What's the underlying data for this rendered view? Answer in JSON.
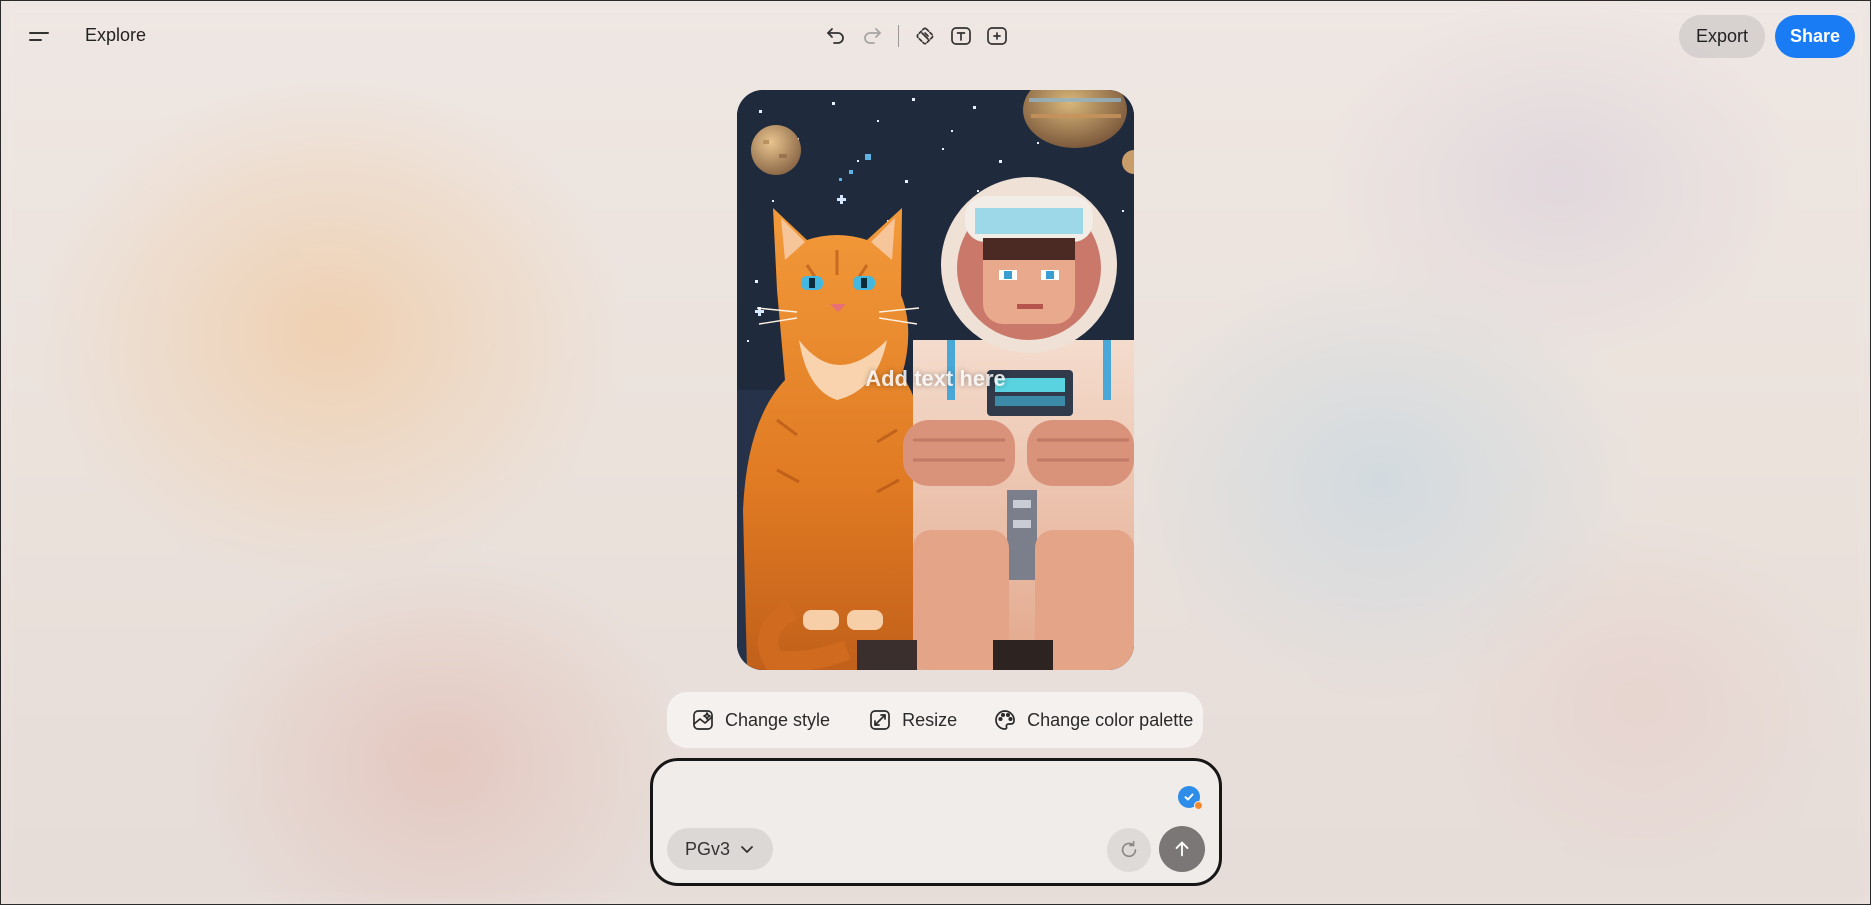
{
  "nav": {
    "explore_label": "Explore"
  },
  "toolbar": {
    "undo_icon": "undo-icon",
    "redo_icon": "redo-icon",
    "tools": [
      "remove-background-icon",
      "text-tool-icon",
      "expand-tool-icon"
    ]
  },
  "header": {
    "export_label": "Export",
    "share_label": "Share",
    "share_color": "#1a7cf5"
  },
  "canvas": {
    "overlay_text": "Add text here"
  },
  "actions": {
    "change_style_label": "Change style",
    "resize_label": "Resize",
    "change_palette_label": "Change color palette"
  },
  "prompt": {
    "value": "",
    "placeholder": "",
    "model_label": "PGv3"
  }
}
